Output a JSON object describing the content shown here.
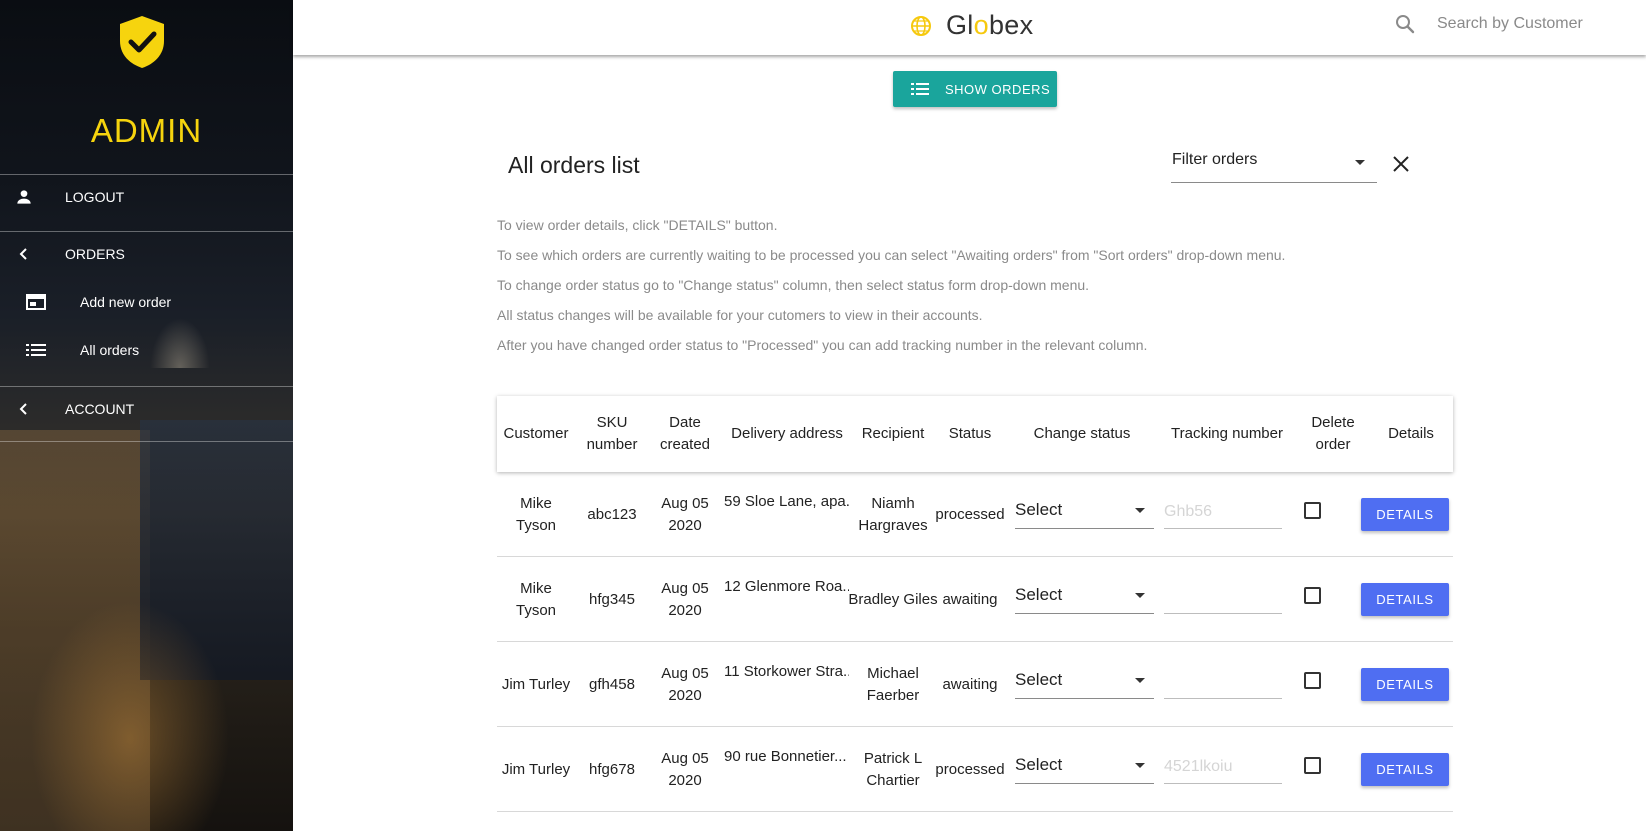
{
  "sidebar": {
    "title": "ADMIN",
    "items": [
      {
        "label": "LOGOUT",
        "icon": "person-icon"
      },
      {
        "label": "ORDERS",
        "icon": "chevron-left-icon"
      },
      {
        "label": "Add new order",
        "icon": "order-form-icon"
      },
      {
        "label": "All orders",
        "icon": "list-icon"
      },
      {
        "label": "ACCOUNT",
        "icon": "chevron-left-icon"
      }
    ]
  },
  "header": {
    "brand": {
      "pre": "Gl",
      "accent": "o",
      "post": "bex"
    },
    "search_placeholder": "Search by Customer"
  },
  "toolbar": {
    "show_orders_label": "SHOW ORDERS"
  },
  "main": {
    "title": "All orders list",
    "filter_label": "Filter orders",
    "help": [
      "To view order details, click \"DETAILS\" button.",
      "To see which orders are currently waiting to be processed you can select \"Awaiting orders\" from \"Sort orders\" drop-down menu.",
      "To change order status go to \"Change status\" column, then select status form drop-down menu.",
      "All status changes will be available for your cutomers to view in their accounts.",
      "After you have changed order status to \"Processed\" you can add tracking number in the relevant column."
    ]
  },
  "table": {
    "headers": {
      "customer": "Customer",
      "sku": "SKU number",
      "date": "Date created",
      "address": "Delivery address",
      "recipient": "Recipient",
      "status": "Status",
      "change_status": "Change status",
      "tracking": "Tracking number",
      "delete": "Delete order",
      "details": "Details"
    },
    "rows": [
      {
        "customer": "Mike Tyson",
        "sku": "abc123",
        "date": "Aug 05 2020",
        "address": "59 Sloe Lane, apa...",
        "recipient": "Niamh Hargraves",
        "status": "processed",
        "select": "Select",
        "tracking_placeholder": "Ghb56",
        "details": "DETAILS"
      },
      {
        "customer": "Mike Tyson",
        "sku": "hfg345",
        "date": "Aug 05 2020",
        "address": "12 Glenmore Roa...",
        "recipient": "Bradley Giles",
        "status": "awaiting",
        "select": "Select",
        "tracking_placeholder": "",
        "details": "DETAILS"
      },
      {
        "customer": "Jim Turley",
        "sku": "gfh458",
        "date": "Aug 05 2020",
        "address": "11 Storkower Stra...",
        "recipient": "Michael Faerber",
        "status": "awaiting",
        "select": "Select",
        "tracking_placeholder": "",
        "details": "DETAILS"
      },
      {
        "customer": "Jim Turley",
        "sku": "hfg678",
        "date": "Aug 05 2020",
        "address": "90 rue Bonnetier...",
        "recipient": "Patrick L Chartier",
        "status": "processed",
        "select": "Select",
        "tracking_placeholder": "4521lkoiu",
        "details": "DETAILS"
      }
    ]
  },
  "colors": {
    "accent_yellow": "#f6d40e",
    "teal_button": "#1aa59c",
    "details_blue": "#4f6ef2"
  }
}
